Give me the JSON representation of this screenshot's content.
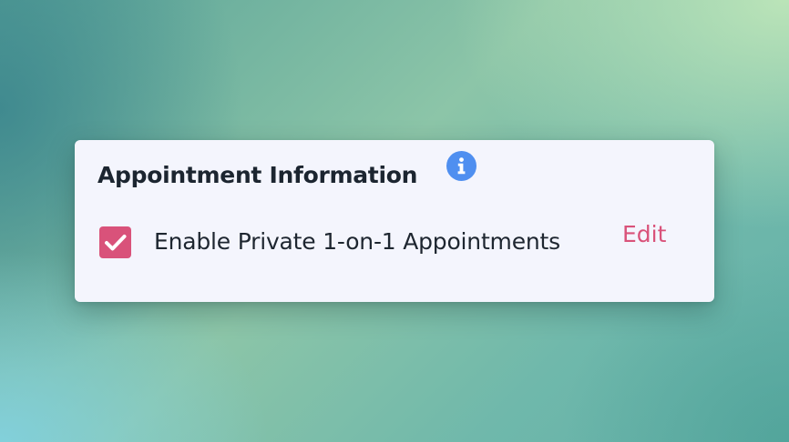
{
  "card": {
    "title": "Appointment Information",
    "info_icon": "info-icon",
    "option": {
      "label": "Enable Private 1-on-1 Appointments",
      "checked": true,
      "check_icon": "checkmark-icon"
    },
    "edit_label": "Edit"
  },
  "colors": {
    "accent": "#d9527a",
    "info": "#4f8ff0",
    "card_background": "#f4f5fd",
    "text": "#1c2530"
  }
}
